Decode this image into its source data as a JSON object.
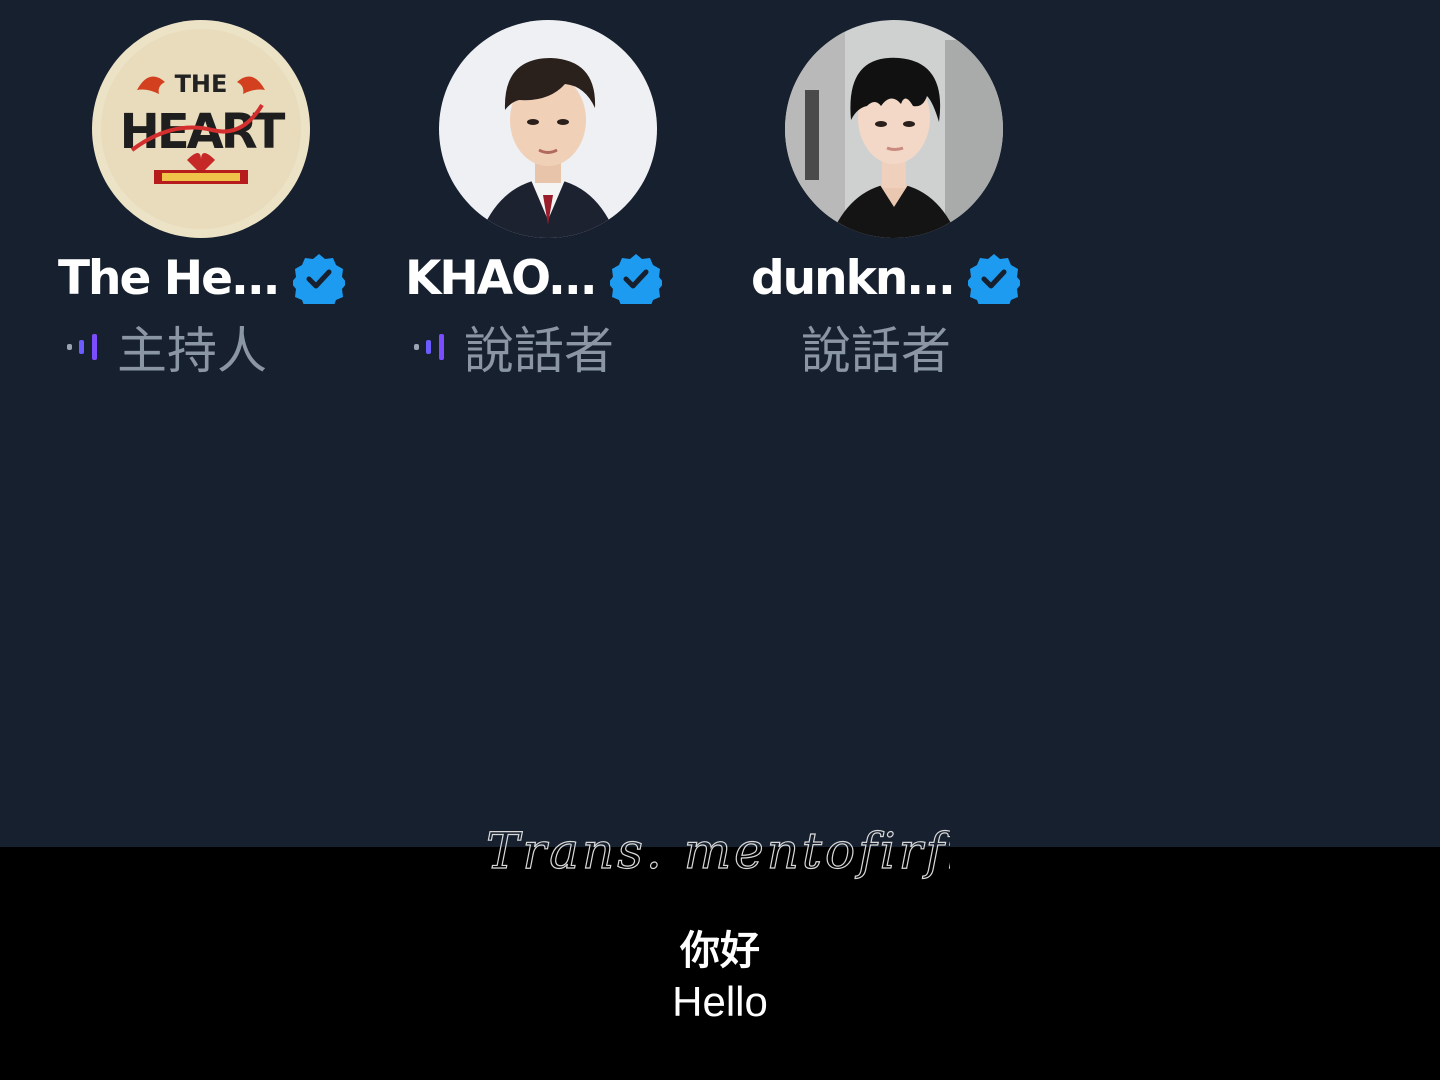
{
  "speakers": [
    {
      "name": "The He...",
      "role": "主持人",
      "verified": true,
      "speaking": true,
      "avatar": "the-heart-logo-avatar",
      "avatar_logo_text": "THE HEART"
    },
    {
      "name": "KHAO...",
      "role": "說話者",
      "verified": true,
      "speaking": true,
      "avatar": "person-photo-avatar"
    },
    {
      "name": "dunkn...",
      "role": "說話者",
      "verified": true,
      "speaking": false,
      "avatar": "person-photo-avatar"
    }
  ],
  "watermark": "Trans. mentofirfir",
  "subtitles": {
    "chinese": "你好",
    "english": "Hello"
  },
  "colors": {
    "panel_background": "#17202e",
    "letterbox": "#000000",
    "verified_badge": "#1d9bf0",
    "speaking_wave": "#7b4dff",
    "role_text": "#8b96a5"
  }
}
